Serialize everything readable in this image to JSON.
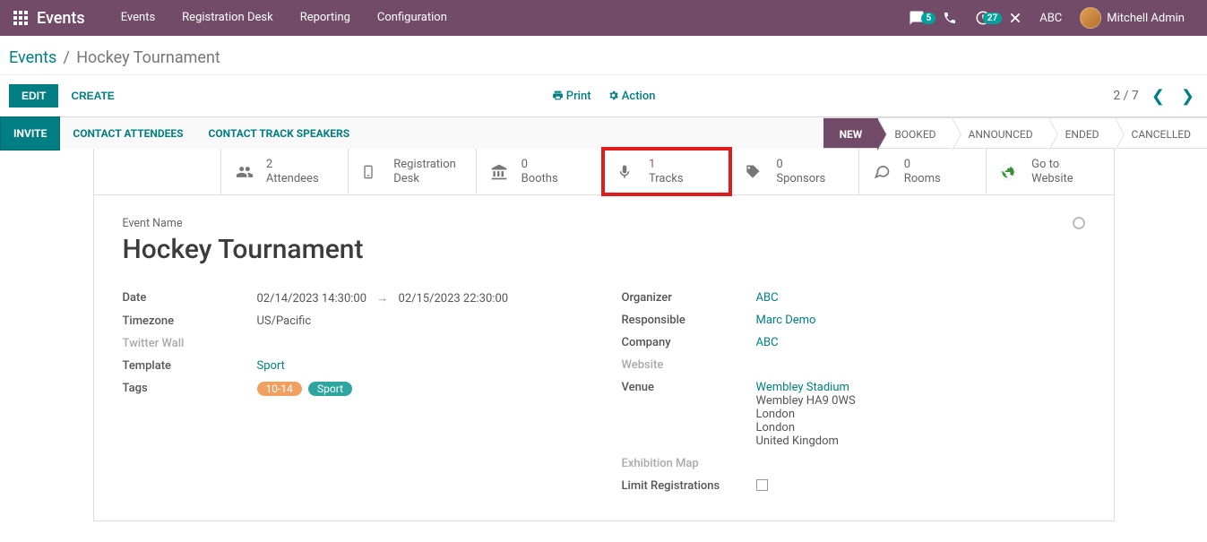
{
  "topbar": {
    "brand": "Events",
    "nav": [
      "Events",
      "Registration Desk",
      "Reporting",
      "Configuration"
    ],
    "msg_badge": "5",
    "clock_badge": "27",
    "company": "ABC",
    "user": "Mitchell Admin"
  },
  "breadcrumb": {
    "root": "Events",
    "current": "Hockey Tournament"
  },
  "controls": {
    "edit": "EDIT",
    "create": "CREATE",
    "print": "Print",
    "action": "Action",
    "pager": "2 / 7"
  },
  "statusbar": {
    "invite": "INVITE",
    "contact_attendees": "CONTACT ATTENDEES",
    "contact_speakers": "CONTACT TRACK SPEAKERS",
    "stages": [
      "NEW",
      "BOOKED",
      "ANNOUNCED",
      "ENDED",
      "CANCELLED"
    ]
  },
  "smartbtns": {
    "attendees": {
      "n": "2",
      "l": "Attendees"
    },
    "regdesk": {
      "n": "Registration",
      "l": "Desk"
    },
    "booths": {
      "n": "0",
      "l": "Booths"
    },
    "tracks": {
      "n": "1",
      "l": "Tracks"
    },
    "sponsors": {
      "n": "0",
      "l": "Sponsors"
    },
    "rooms": {
      "n": "0",
      "l": "Rooms"
    },
    "website": {
      "n": "Go to",
      "l": "Website"
    }
  },
  "form": {
    "event_name_label": "Event Name",
    "event_name": "Hockey Tournament",
    "left": {
      "date_l": "Date",
      "date_from": "02/14/2023 14:30:00",
      "date_to": "02/15/2023 22:30:00",
      "tz_l": "Timezone",
      "tz": "US/Pacific",
      "twitter_l": "Twitter Wall",
      "template_l": "Template",
      "template": "Sport",
      "tags_l": "Tags",
      "tag1": "10-14",
      "tag2": "Sport"
    },
    "right": {
      "org_l": "Organizer",
      "org": "ABC",
      "resp_l": "Responsible",
      "resp": "Marc Demo",
      "comp_l": "Company",
      "comp": "ABC",
      "web_l": "Website",
      "venue_l": "Venue",
      "venue_name": "Wembley Stadium",
      "venue_l2": "Wembley HA9 0WS",
      "venue_l3": "London",
      "venue_l4": "London",
      "venue_l5": "United Kingdom",
      "exmap_l": "Exhibition Map",
      "limit_l": "Limit Registrations"
    }
  }
}
